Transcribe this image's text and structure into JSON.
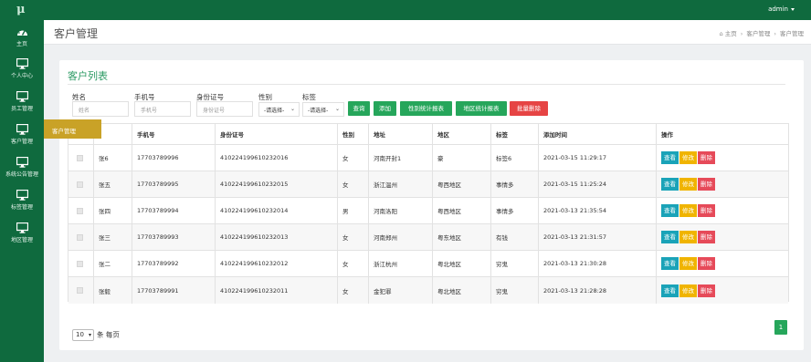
{
  "topbar": {
    "logo": "μ",
    "user": "admin"
  },
  "sidebar": {
    "items": [
      {
        "label": "主页",
        "icon": "dashboard-icon"
      },
      {
        "label": "个人中心",
        "icon": "monitor-icon"
      },
      {
        "label": "员工管理",
        "icon": "monitor-icon"
      },
      {
        "label": "客户管理",
        "icon": "monitor-icon"
      },
      {
        "label": "系统公告管理",
        "icon": "monitor-icon"
      },
      {
        "label": "标签管理",
        "icon": "monitor-icon"
      },
      {
        "label": "地区管理",
        "icon": "monitor-icon"
      }
    ]
  },
  "flyout": {
    "label": "客户管理"
  },
  "header": {
    "title": "客户管理",
    "breadcrumb": [
      "主页",
      "客户管理",
      "客户管理"
    ]
  },
  "card": {
    "title": "客户列表"
  },
  "filters": {
    "name_label": "姓名",
    "name_placeholder": "姓名",
    "phone_label": "手机号",
    "phone_placeholder": "手机号",
    "idcard_label": "身份证号",
    "idcard_placeholder": "身份证号",
    "gender_label": "性别",
    "gender_value": "-请选择-",
    "tag_label": "标签",
    "tag_value": "-请选择-"
  },
  "buttons": {
    "query": "查询",
    "add": "添加",
    "gender_report": "性别统计报表",
    "region_report": "地区统计报表",
    "batch_delete": "批量删除"
  },
  "table": {
    "headers": [
      "",
      "",
      "手机号",
      "身份证号",
      "性别",
      "地址",
      "地区",
      "标签",
      "添加时间",
      "操作"
    ],
    "rows": [
      {
        "name": "张6",
        "phone": "17703789996",
        "idcard": "410224199610232016",
        "gender": "女",
        "address": "河南开封1",
        "region": "豪",
        "tag": "标签6",
        "time": "2021-03-15 11:29:17"
      },
      {
        "name": "张五",
        "phone": "17703789995",
        "idcard": "410224199610232015",
        "gender": "女",
        "address": "浙江温州",
        "region": "粤西地区",
        "tag": "事情多",
        "time": "2021-03-15 11:25:24"
      },
      {
        "name": "张四",
        "phone": "17703789994",
        "idcard": "410224199610232014",
        "gender": "男",
        "address": "河南洛阳",
        "region": "粤西地区",
        "tag": "事情多",
        "time": "2021-03-13 21:35:54"
      },
      {
        "name": "张三",
        "phone": "17703789993",
        "idcard": "410224199610232013",
        "gender": "女",
        "address": "河南郑州",
        "region": "粤东地区",
        "tag": "有钱",
        "time": "2021-03-13 21:31:57"
      },
      {
        "name": "张二",
        "phone": "17703789992",
        "idcard": "410224199610232012",
        "gender": "女",
        "address": "浙江杭州",
        "region": "粤北地区",
        "tag": "穷鬼",
        "time": "2021-03-13 21:30:28"
      },
      {
        "name": "张毅",
        "phone": "17703789991",
        "idcard": "410224199610232011",
        "gender": "女",
        "address": "金犯罪",
        "region": "粤北地区",
        "tag": "穷鬼",
        "time": "2021-03-13 21:28:28"
      }
    ],
    "actions": {
      "view": "查看",
      "edit": "修改",
      "delete": "删除"
    }
  },
  "pager": {
    "size": "10",
    "size_suffix": "条 每页",
    "page": "1"
  },
  "colors": {
    "primary": "#0f6a3e",
    "accent": "#26a65b",
    "flyout": "#c9a227",
    "danger": "#e64444",
    "info": "#1aa3b8",
    "warning": "#f0b400"
  }
}
